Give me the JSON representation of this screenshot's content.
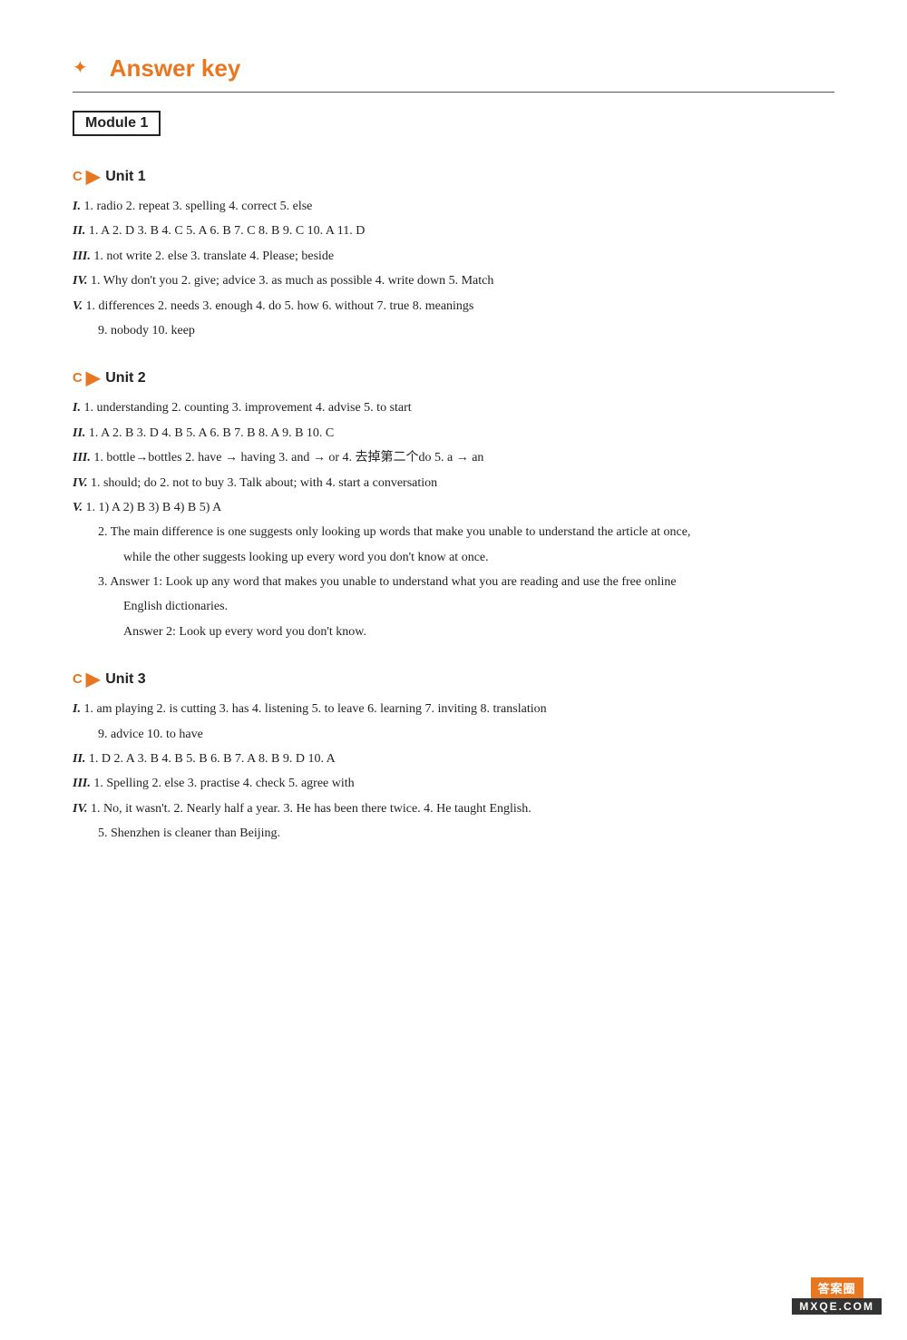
{
  "page": {
    "title": "Answer key",
    "module": "Module 1",
    "units": [
      {
        "id": "unit1",
        "label": "Unit 1",
        "sections": [
          {
            "roman": "I.",
            "text": "1. radio  2. repeat  3. spelling  4. correct  5. else"
          },
          {
            "roman": "II.",
            "text": "1. A  2. D  3. B  4. C  5. A  6. B  7. C  8. B  9. C  10. A  11. D"
          },
          {
            "roman": "III.",
            "text": "1. not write  2. else  3. translate  4. Please; beside"
          },
          {
            "roman": "IV.",
            "text": "1. Why don't you  2. give; advice  3. as much as possible  4. write down  5. Match"
          },
          {
            "roman": "V.",
            "text": "1. differences  2. needs  3. enough  4. do  5. how  6. without  7. true  8. meanings"
          },
          {
            "roman": "",
            "text": "9. nobody  10. keep",
            "indent": true
          }
        ]
      },
      {
        "id": "unit2",
        "label": "Unit 2",
        "sections": [
          {
            "roman": "I.",
            "text": "1. understanding  2. counting  3. improvement  4. advise  5. to start"
          },
          {
            "roman": "II.",
            "text": "1. A  2. B  3. D  4. B  5. A  6. B  7. B  8. A  9. B  10. C"
          },
          {
            "roman": "III.",
            "text": "1. bottle→bottles  2. have → having  3. and → or  4. 去掉第二个do  5. a → an"
          },
          {
            "roman": "IV.",
            "text": "1. should; do  2. not to buy  3. Talk about; with  4. start a conversation"
          },
          {
            "roman": "V.",
            "text": "1. 1) A  2) B  3) B  4) B  5) A"
          },
          {
            "roman": "",
            "text": "2. The main difference is one suggests only looking up words that make you unable to understand the article at once,",
            "indent": true
          },
          {
            "roman": "",
            "text": "while the other suggests looking up every word you don't know at once.",
            "indent2": true
          },
          {
            "roman": "",
            "text": "3. Answer 1: Look up any word that makes you unable to understand what you are reading and use the free online",
            "indent": true
          },
          {
            "roman": "",
            "text": "English dictionaries.",
            "indent2": true
          },
          {
            "roman": "",
            "text": "Answer 2: Look up every word you don't know.",
            "indent2": true
          }
        ]
      },
      {
        "id": "unit3",
        "label": "Unit 3",
        "sections": [
          {
            "roman": "I.",
            "text": "1. am playing  2. is cutting  3. has  4. listening  5. to leave  6. learning  7. inviting  8. translation"
          },
          {
            "roman": "",
            "text": "9. advice  10. to have",
            "indent": true
          },
          {
            "roman": "II.",
            "text": "1. D  2. A  3. B  4. B  5. B  6. B  7. A  8. B  9. D  10. A"
          },
          {
            "roman": "III.",
            "text": "1. Spelling  2. else  3. practise  4. check  5. agree with"
          },
          {
            "roman": "IV.",
            "text": "1. No, it wasn't.  2. Nearly half a year.  3. He has been there twice.  4. He taught English."
          },
          {
            "roman": "",
            "text": "5. Shenzhen is cleaner than Beijing.",
            "indent": true
          }
        ]
      }
    ],
    "watermark": {
      "top": "答案圈",
      "bottom": "MXQE.COM"
    }
  }
}
